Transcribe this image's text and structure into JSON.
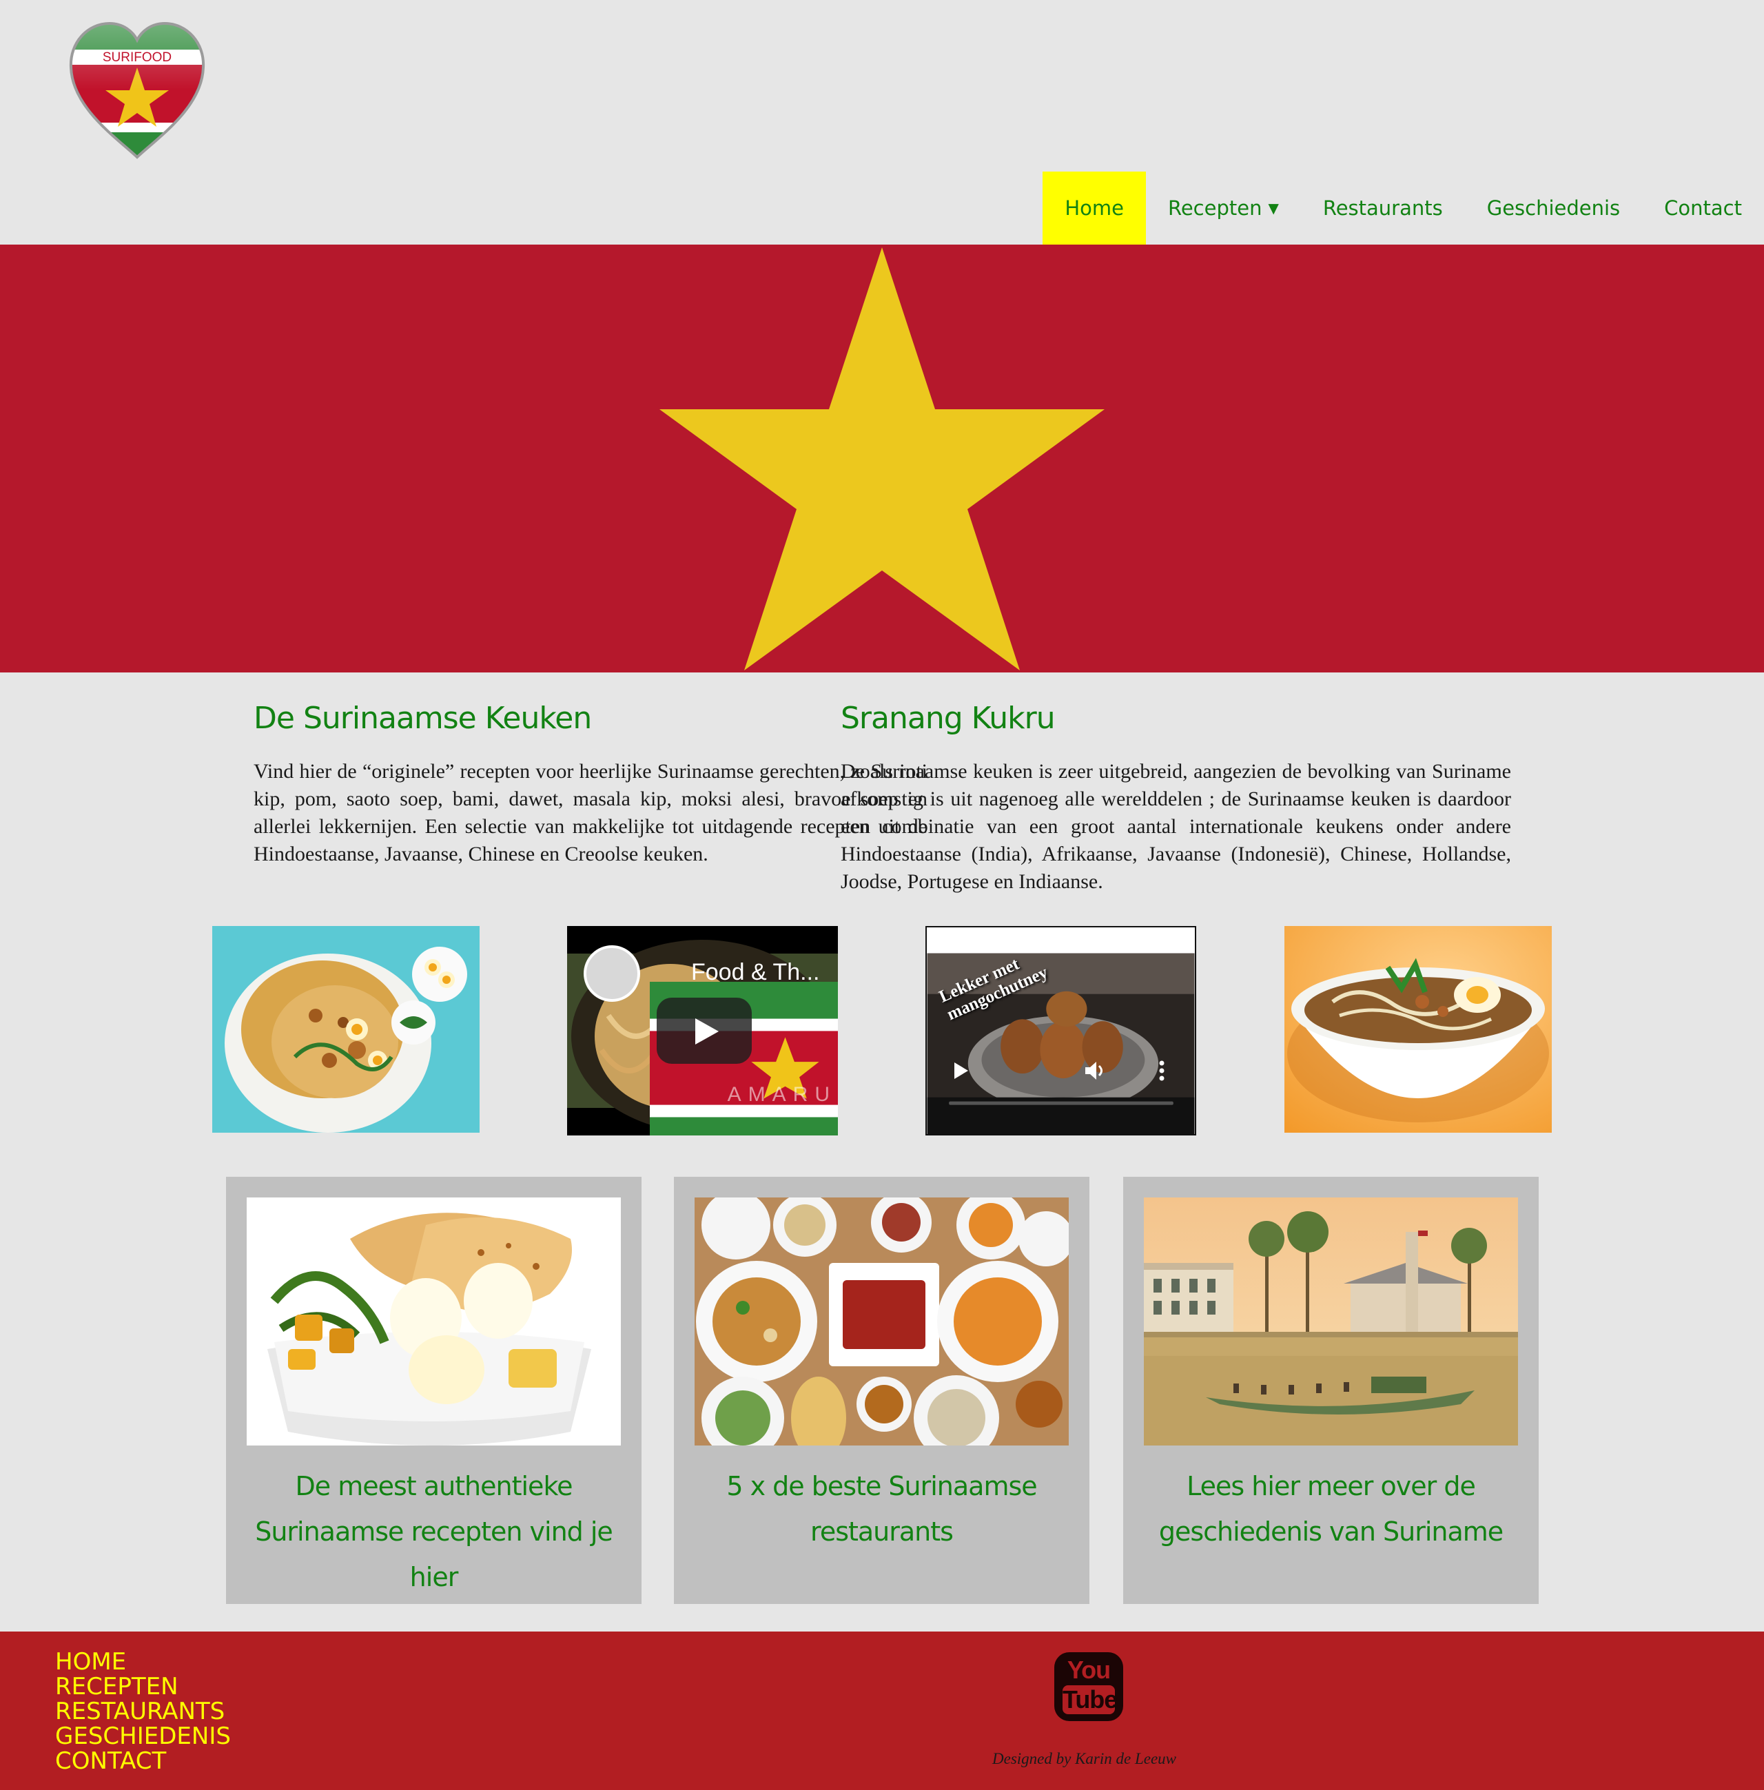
{
  "logo": {
    "text": "SURIFOOD"
  },
  "nav": {
    "items": [
      {
        "label": "Home",
        "active": true
      },
      {
        "label": "Recepten",
        "has_dropdown": true
      },
      {
        "label": "Restaurants"
      },
      {
        "label": "Geschiedenis"
      },
      {
        "label": "Contact"
      }
    ],
    "active_color": "#ffff00",
    "text_color": "#128213"
  },
  "hero": {
    "background": "#b5182c",
    "star_color": "#ecc81e",
    "icon": "star-icon"
  },
  "intro": {
    "left": {
      "title": "De Surinaamse Keuken",
      "body": "Vind hier de “originele” recepten voor heerlijke Surinaamse gerechten, zoals roti kip, pom, saoto soep, bami, dawet, masala kip, moksi alesi, bravoe soep en allerlei lekkernijen. Een selectie van makkelijke tot uitdagende recepten uit de Hindoestaanse, Javaanse, Chinese en Creoolse keuken."
    },
    "right": {
      "title": "Sranang Kukru",
      "body": "De Surinaamse keuken is zeer uitgebreid, aangezien de bevolking van Suriname afkomstig is uit nagenoeg alle werelddelen ; de Surinaamse keuken is daardoor een combinatie van een groot aantal internationale keukens onder andere Hindoestaanse (India), Afrikaanse, Javaanse (Indonesië), Chinese, Hollandse, Joodse, Portugese en Indiaanse."
    }
  },
  "media": {
    "video1": {
      "title": "Food & Th...",
      "brand": "AMARU"
    },
    "video2": {
      "caption_line1": "Lekker met",
      "caption_line2": "mangochutney"
    }
  },
  "cards": [
    {
      "text": "De meest authentieke Surinaamse recepten vind je hier"
    },
    {
      "text": "5 x de beste Surinaamse restaurants"
    },
    {
      "text": "Lees hier meer over de geschiedenis van Suriname"
    }
  ],
  "footer": {
    "links": [
      "HOME",
      "RECEPTEN",
      "RESTAURANTS",
      "GESCHIEDENIS",
      "CONTACT"
    ],
    "youtube": {
      "line1": "You",
      "line2": "Tube"
    },
    "credit": "Designed by Karin de Leeuw",
    "background": "#b21e22",
    "link_color": "#ffff00"
  }
}
